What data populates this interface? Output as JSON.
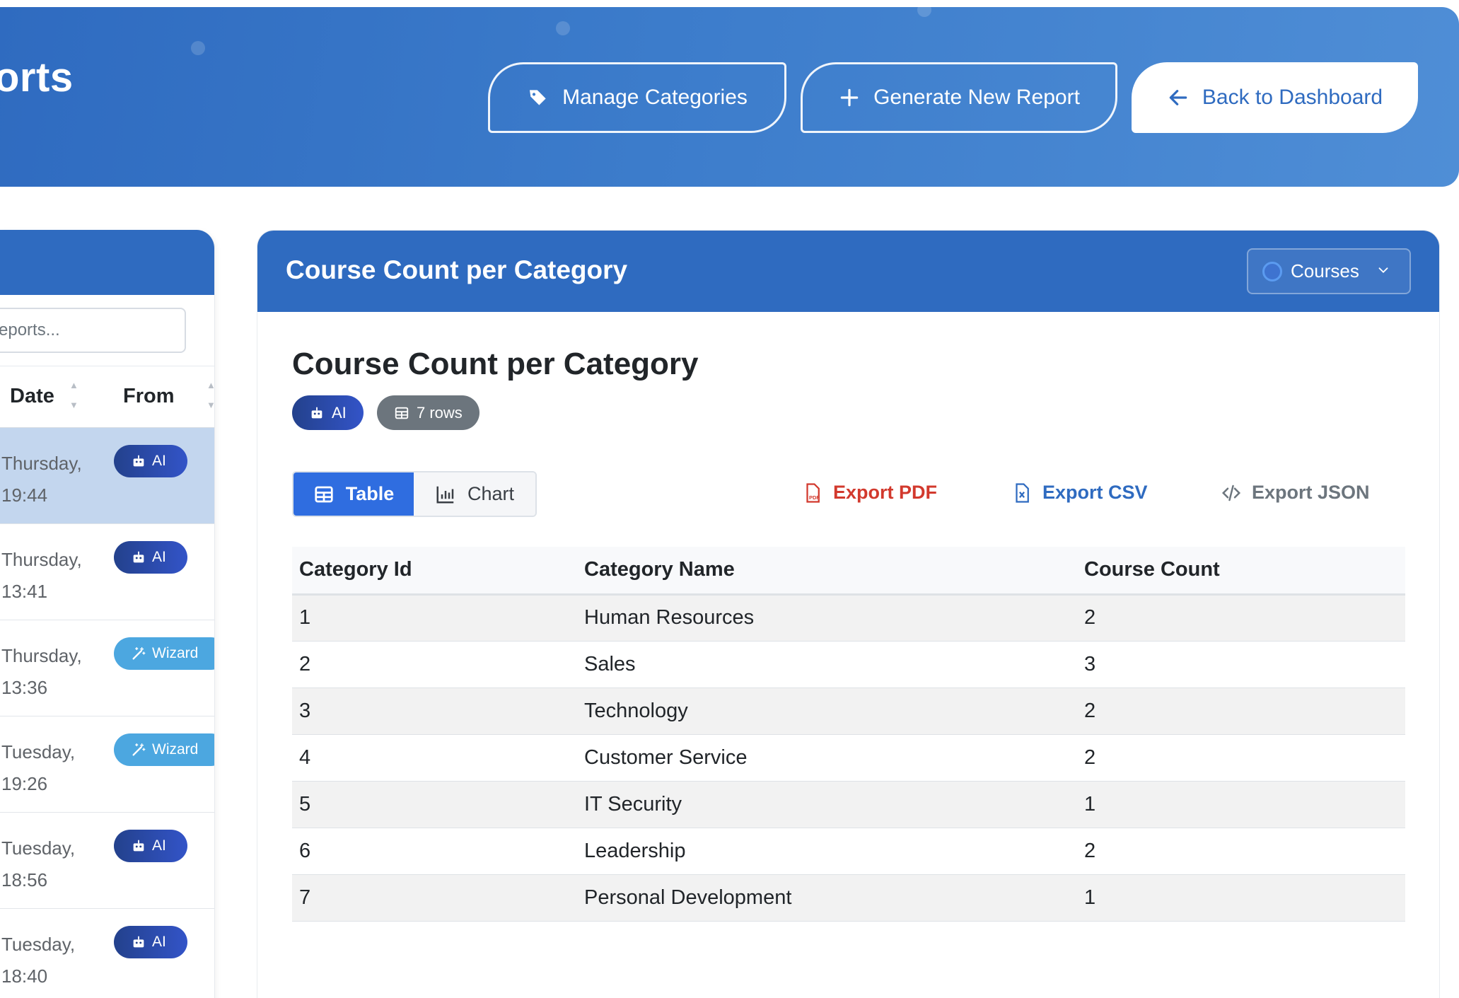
{
  "header": {
    "title": "orts",
    "buttons": {
      "manage": "Manage Categories",
      "generate": "Generate New Report",
      "back": "Back to Dashboard"
    }
  },
  "sidebar": {
    "search_placeholder": "eports...",
    "columns": {
      "date": "Date",
      "from": "From"
    },
    "rows": [
      {
        "day": "Thursday,",
        "time": "19:44",
        "source": "AI",
        "type": "ai"
      },
      {
        "day": "Thursday,",
        "time": "13:41",
        "source": "AI",
        "type": "ai"
      },
      {
        "day": "Thursday,",
        "time": "13:36",
        "source": "Wizard",
        "type": "wizard"
      },
      {
        "day": "Tuesday,",
        "time": "19:26",
        "source": "Wizard",
        "type": "wizard"
      },
      {
        "day": "Tuesday,",
        "time": "18:56",
        "source": "AI",
        "type": "ai"
      },
      {
        "day": "Tuesday,",
        "time": "18:40",
        "source": "AI",
        "type": "ai"
      }
    ]
  },
  "report": {
    "panel_title": "Course Count per Category",
    "dropdown_value": "Courses",
    "title": "Course Count per Category",
    "tags": {
      "source": "AI",
      "rows": "7 rows"
    },
    "view_toggle": {
      "table": "Table",
      "chart": "Chart"
    },
    "exports": {
      "pdf": "Export PDF",
      "csv": "Export CSV",
      "json": "Export JSON"
    },
    "table": {
      "columns": [
        "Category Id",
        "Category Name",
        "Course Count"
      ],
      "rows": [
        [
          "1",
          "Human Resources",
          "2"
        ],
        [
          "2",
          "Sales",
          "3"
        ],
        [
          "3",
          "Technology",
          "2"
        ],
        [
          "4",
          "Customer Service",
          "2"
        ],
        [
          "5",
          "IT Security",
          "1"
        ],
        [
          "6",
          "Leadership",
          "2"
        ],
        [
          "7",
          "Personal Development",
          "1"
        ]
      ]
    }
  },
  "colors": {
    "primary": "#2f6bc0",
    "active_toggle": "#2f6de0",
    "ai_badge": "#23418c",
    "wizard_badge": "#4ca7e0",
    "pdf": "#d2392d",
    "rows_badge": "#6c757d"
  }
}
